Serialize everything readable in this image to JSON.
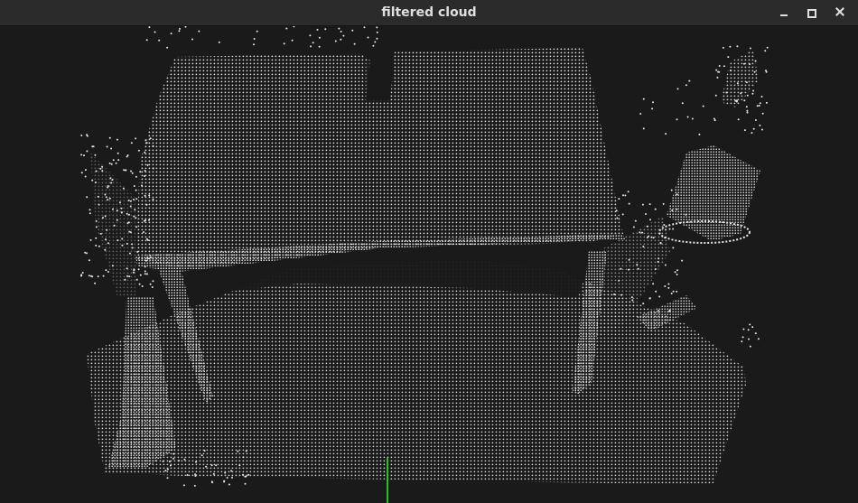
{
  "window": {
    "title": "filtered cloud",
    "controls": {
      "minimize_icon": "minimize-icon",
      "maximize_icon": "maximize-icon",
      "close_icon": "close-icon"
    }
  },
  "viewer": {
    "background_color": "#1a1a1a",
    "point_color": "#e6e6e6",
    "axis_color": "#22c422",
    "objects": [
      "floor-plane",
      "table-top",
      "table-leg",
      "cylinder-object",
      "clutter"
    ]
  }
}
